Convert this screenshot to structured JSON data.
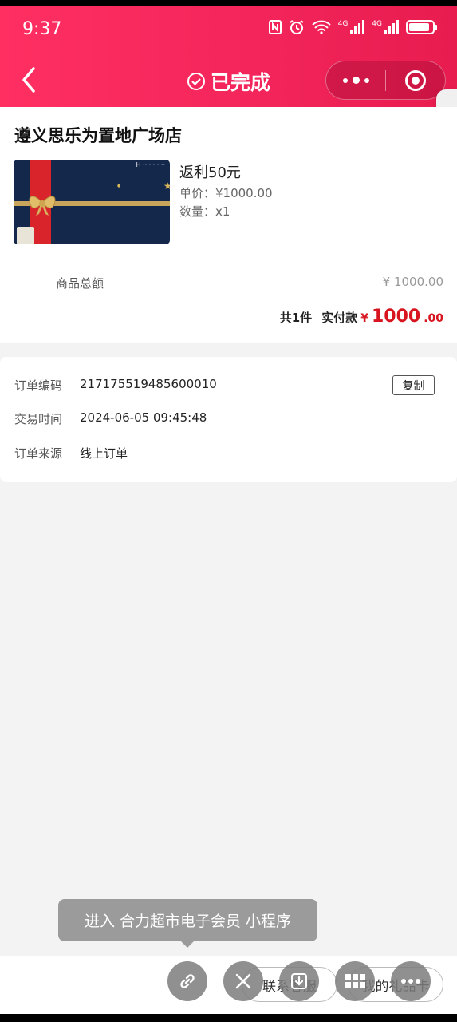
{
  "status": {
    "time": "9:37",
    "net1": "4G",
    "net2": "4G"
  },
  "header": {
    "title": "已完成"
  },
  "order": {
    "store": "遵义思乐为置地广场店",
    "product": {
      "name": "返利50元",
      "price": "单价：¥1000.00",
      "qty": "数量：x1"
    },
    "subtotal_label": "商品总额",
    "subtotal_value": "¥ 1000.00",
    "count": "共1件",
    "paid_label": "实付款",
    "currency": "¥",
    "paid_int": "1000",
    "paid_dec": ".00"
  },
  "info": {
    "order_no_label": "订单编码",
    "order_no": "217175519485600010",
    "copy": "复制",
    "time_label": "交易时间",
    "time": "2024-06-05 09:45:48",
    "source_label": "订单来源",
    "source": "线上订单"
  },
  "tooltip": {
    "text": "进入 合力超市电子会员 小程序"
  },
  "bottom": {
    "contact": "联系客服",
    "giftcard": "我的礼品卡"
  },
  "colors": {
    "primary": "#f2245a",
    "price": "#d7141f"
  }
}
